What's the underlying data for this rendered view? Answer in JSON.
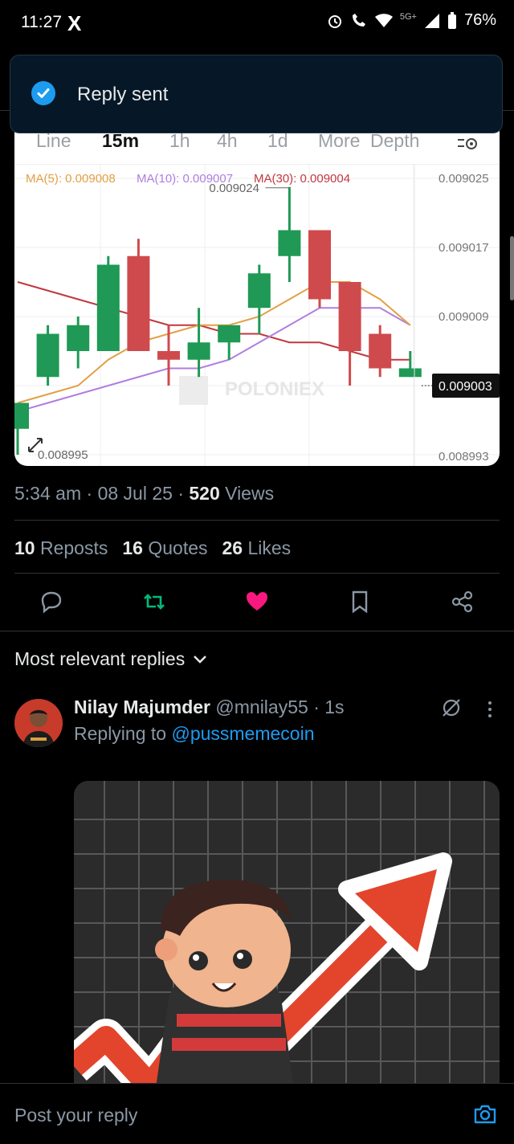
{
  "status_bar": {
    "time": "11:27",
    "app_glyph": "X",
    "network": "5G+",
    "battery": "76%",
    "icons": [
      "alarm-icon",
      "wifi-call-icon",
      "wifi-icon",
      "signal-icon",
      "battery-icon"
    ]
  },
  "toast": {
    "text": "Reply sent",
    "icon": "check-circle-icon",
    "accent": "#1d9bf0"
  },
  "chart": {
    "tabs": [
      "Line",
      "15m",
      "1h",
      "4h",
      "1d",
      "More",
      "Depth"
    ],
    "active_tab": "15m",
    "settings_icon": "chart-settings-icon",
    "ma_legend": [
      {
        "label": "MA(5): 0.009008",
        "color": "#e2a045"
      },
      {
        "label": "MA(10): 0.009007",
        "color": "#b07ee0"
      },
      {
        "label": "MA(30): 0.009004",
        "color": "#c0393f"
      }
    ],
    "watermark": "POLONIEX",
    "high_label": "0.009024",
    "low_label": "0.008995",
    "last_price": "0.009003",
    "expand_icon": "expand-icon"
  },
  "chart_data": {
    "type": "candlestick",
    "y_ticks": [
      "0.009025",
      "0.009017",
      "0.009009",
      "0.009003",
      "0.008993"
    ],
    "ylim": [
      0.008993,
      0.009025
    ],
    "candles": [
      {
        "open": 0.008996,
        "high": 0.008998,
        "low": 0.008993,
        "close": 0.008999,
        "dir": "up"
      },
      {
        "open": 0.009002,
        "high": 0.009008,
        "low": 0.009001,
        "close": 0.009007,
        "dir": "up"
      },
      {
        "open": 0.009008,
        "high": 0.009009,
        "low": 0.009003,
        "close": 0.009005,
        "dir": "up"
      },
      {
        "open": 0.009005,
        "high": 0.009016,
        "low": 0.009005,
        "close": 0.009015,
        "dir": "up"
      },
      {
        "open": 0.009016,
        "high": 0.009018,
        "low": 0.009005,
        "close": 0.009005,
        "dir": "down"
      },
      {
        "open": 0.009005,
        "high": 0.009008,
        "low": 0.009001,
        "close": 0.009004,
        "dir": "down"
      },
      {
        "open": 0.009004,
        "high": 0.00901,
        "low": 0.009002,
        "close": 0.009006,
        "dir": "up"
      },
      {
        "open": 0.009006,
        "high": 0.009008,
        "low": 0.009004,
        "close": 0.009008,
        "dir": "up"
      },
      {
        "open": 0.00901,
        "high": 0.009015,
        "low": 0.009007,
        "close": 0.009014,
        "dir": "up"
      },
      {
        "open": 0.009016,
        "high": 0.009024,
        "low": 0.009013,
        "close": 0.009019,
        "dir": "up"
      },
      {
        "open": 0.009019,
        "high": 0.009019,
        "low": 0.00901,
        "close": 0.009011,
        "dir": "down"
      },
      {
        "open": 0.009013,
        "high": 0.009013,
        "low": 0.009001,
        "close": 0.009005,
        "dir": "down"
      },
      {
        "open": 0.009007,
        "high": 0.009008,
        "low": 0.009002,
        "close": 0.009003,
        "dir": "down"
      },
      {
        "open": 0.009003,
        "high": 0.009005,
        "low": 0.009002,
        "close": 0.009002,
        "dir": "up"
      }
    ],
    "ma5": [
      0.008999,
      0.009,
      0.009001,
      0.009004,
      0.009006,
      0.009007,
      0.009008,
      0.009008,
      0.009009,
      0.009011,
      0.009013,
      0.009013,
      0.009011,
      0.009008
    ],
    "ma10": [
      0.008998,
      0.008999,
      0.009,
      0.009001,
      0.009002,
      0.009003,
      0.009003,
      0.009004,
      0.009006,
      0.009008,
      0.00901,
      0.00901,
      0.00901,
      0.009008
    ],
    "ma30": [
      0.009013,
      0.009012,
      0.009011,
      0.00901,
      0.009009,
      0.009008,
      0.009008,
      0.009007,
      0.009007,
      0.009006,
      0.009006,
      0.009005,
      0.009004,
      0.009004
    ]
  },
  "post": {
    "time": "5:34 am",
    "date": "08 Jul 25",
    "views_count": "520",
    "views_label": "Views",
    "reposts_count": "10",
    "reposts_label": "Reposts",
    "quotes_count": "16",
    "quotes_label": "Quotes",
    "likes_count": "26",
    "likes_label": "Likes"
  },
  "actions": [
    "reply-icon",
    "repost-icon",
    "like-icon",
    "bookmark-icon",
    "share-icon"
  ],
  "colors": {
    "repost_active": "#00ba7c",
    "like_active": "#f91880",
    "link": "#1d9bf0",
    "up": "#1f9955",
    "down": "#cf4a4d"
  },
  "replies": {
    "header": "Most relevant replies",
    "item": {
      "name": "Nilay Majumder",
      "handle": "@mnilay55",
      "time": "· 1s",
      "replying_prefix": "Replying to",
      "replying_handle": "@pussmemecoin"
    }
  },
  "composer": {
    "placeholder": "Post your reply",
    "icon": "camera-icon"
  }
}
